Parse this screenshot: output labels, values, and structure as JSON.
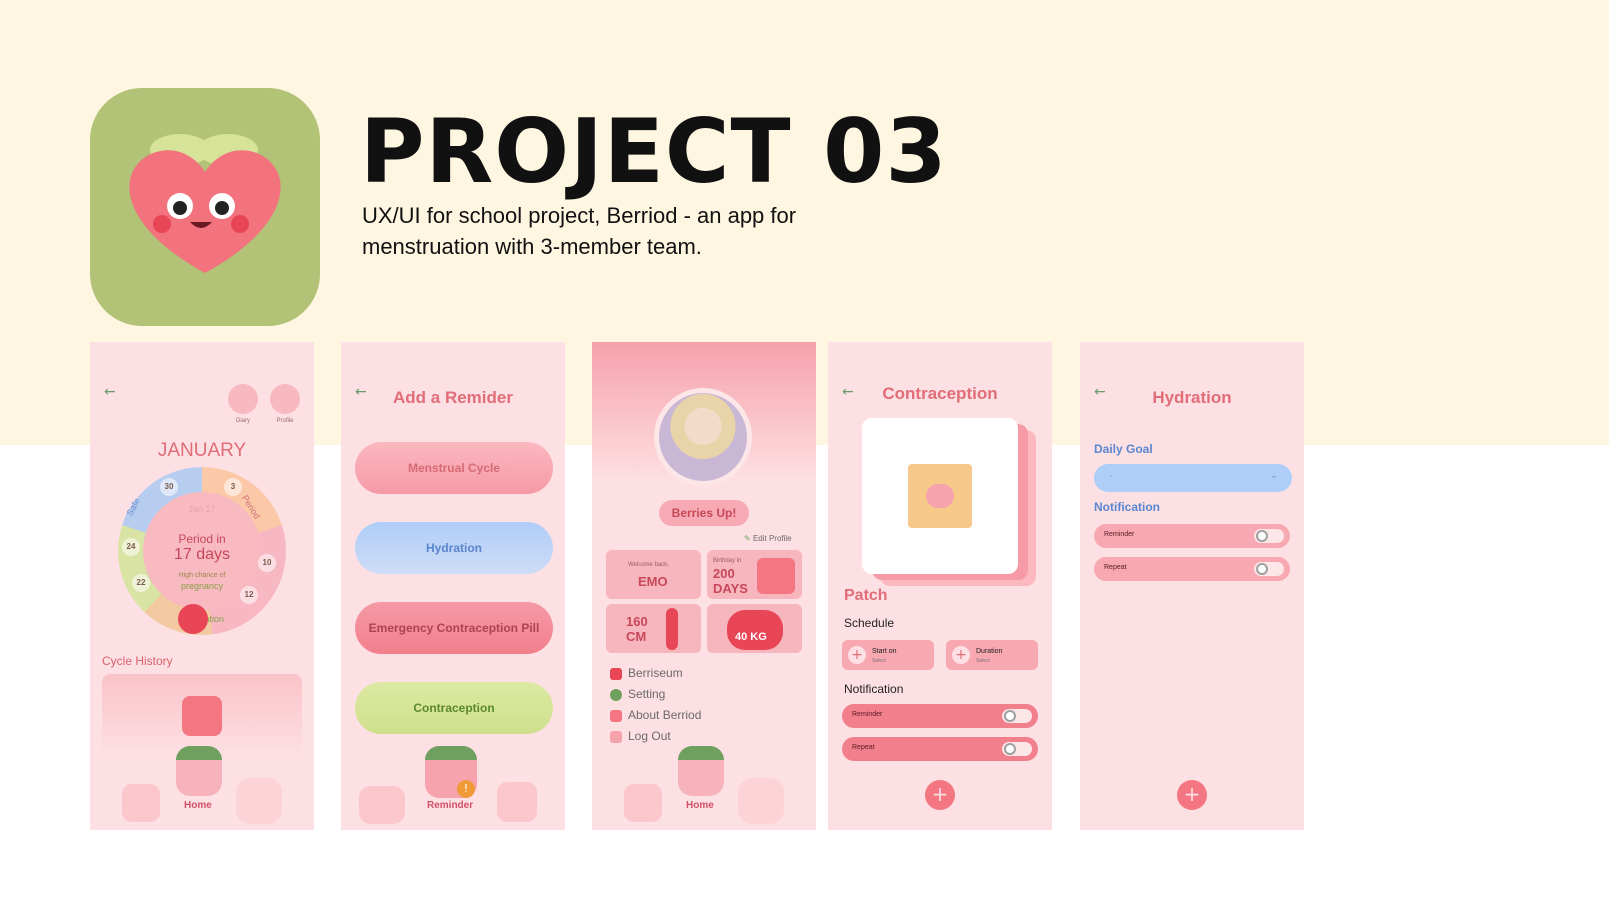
{
  "header": {
    "title": "PROJECT 03",
    "subtitle": "UX/UI for school project, Berriod - an app for menstruation with 3-member team."
  },
  "colors": {
    "band": "#fff6e2",
    "icon_bg": "#b2c276",
    "pink": "#fde0e3",
    "accent": "#e06d78",
    "blue": "#5a86cf",
    "green": "#5b8a2c"
  },
  "screen1": {
    "top_icons": [
      {
        "label": "Diary",
        "icon": "diary-icon"
      },
      {
        "label": "Profile",
        "icon": "profile-icon"
      }
    ],
    "month": "JANUARY",
    "date": "Jan 17",
    "period_line1": "Period in",
    "period_line2": "17 days",
    "chance_line1": "High chance of",
    "chance_line2": "pregnancy",
    "wheel_numbers": [
      "30",
      "3",
      "24",
      "10",
      "22",
      "12"
    ],
    "arc_labels": {
      "safe": "Safe",
      "period": "Period",
      "ovulation": "Ovulation"
    },
    "history_label": "Cycle History",
    "nav_home": "Home"
  },
  "screen2": {
    "title": "Add a Remider",
    "items": [
      "Menstrual Cycle",
      "Hydration",
      "Emergency Contraception Pill",
      "Contraception"
    ],
    "nav_reminder": "Reminder"
  },
  "screen3": {
    "badge": "Berries Up!",
    "edit": "Edit Profile",
    "welcome_small": "Welcome back,",
    "welcome_name": "EMO",
    "birthday_small": "Birthday in",
    "birthday_value": "200",
    "birthday_unit": "DAYS",
    "height_value": "160",
    "height_unit": "CM",
    "weight": "40 KG",
    "menu": [
      "Berriseum",
      "Setting",
      "About Berriod",
      "Log Out"
    ],
    "nav_home": "Home"
  },
  "screen4": {
    "title": "Contraception",
    "patch": "Patch",
    "schedule": "Schedule",
    "chips": [
      {
        "title": "Start on",
        "sub": "Select"
      },
      {
        "title": "Duration",
        "sub": "Select"
      }
    ],
    "notification": "Notification",
    "toggles": [
      "Reminder",
      "Repeat"
    ],
    "fab": "+"
  },
  "screen5": {
    "title": "Hydration",
    "daily_goal": "Daily Goal",
    "goal_value": "-",
    "notification": "Notification",
    "toggles": [
      "Reminder",
      "Repeat"
    ],
    "fab": "+"
  }
}
